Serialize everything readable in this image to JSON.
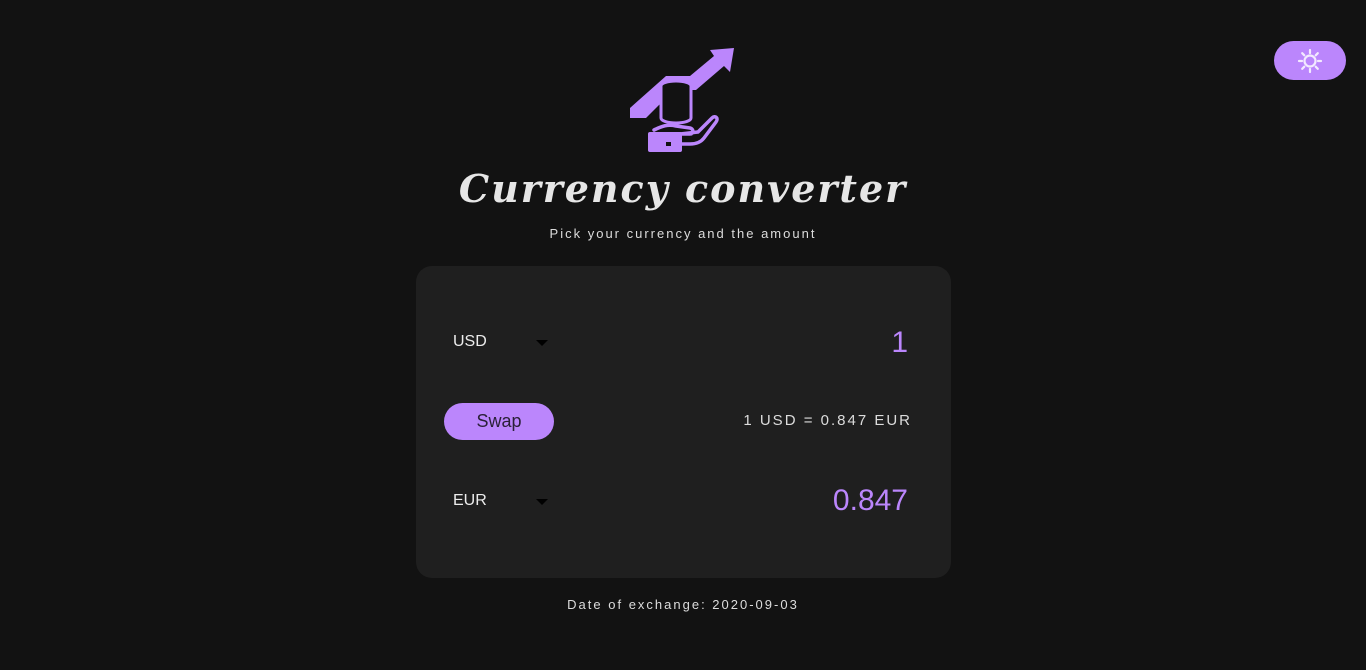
{
  "header": {
    "title": "Currency converter",
    "subtitle": "Pick your currency and the amount"
  },
  "theme_toggle": {
    "icon": "sun-icon"
  },
  "logo": {
    "icon": "hand-coins-growth-icon",
    "accent_color": "#bb86fc"
  },
  "converter": {
    "from": {
      "currency": "USD",
      "amount": "1"
    },
    "swap_label": "Swap",
    "rate_text": "1 USD = 0.847 EUR",
    "to": {
      "currency": "EUR",
      "amount": "0.847"
    }
  },
  "footer": {
    "date_text": "Date of exchange: 2020-09-03"
  },
  "colors": {
    "background": "#121212",
    "card": "#1f1f1f",
    "accent": "#bb86fc"
  }
}
